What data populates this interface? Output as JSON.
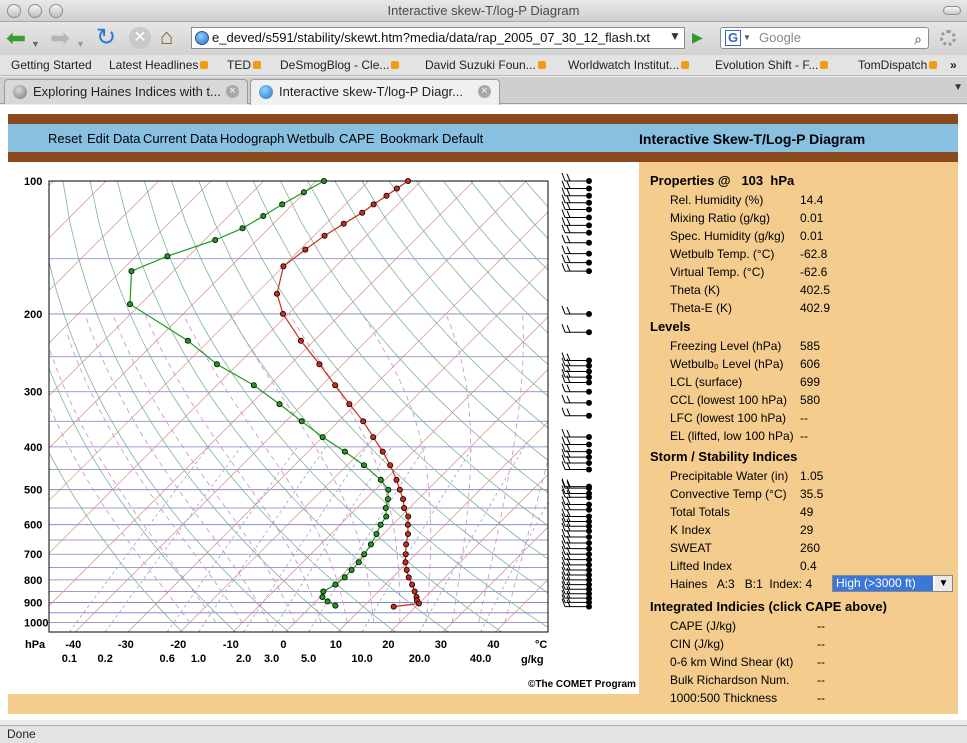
{
  "window": {
    "title": "Interactive skew-T/log-P Diagram"
  },
  "toolbar": {
    "url": "e_deved/s591/stability/skewt.htm?media/data/rap_2005_07_30_12_flash.txt",
    "search_placeholder": "Google",
    "back_icon": "back-arrow-icon",
    "forward_icon": "forward-arrow-icon",
    "reload_icon": "reload-icon",
    "stop_icon": "stop-icon",
    "home_icon": "home-icon"
  },
  "bookmarks": [
    {
      "label": "Getting Started",
      "rss": false
    },
    {
      "label": "Latest Headlines",
      "rss": true
    },
    {
      "label": "TED",
      "rss": true
    },
    {
      "label": "DeSmogBlog - Cle...",
      "rss": true
    },
    {
      "label": "David Suzuki Foun...",
      "rss": true
    },
    {
      "label": "Worldwatch Institut...",
      "rss": true
    },
    {
      "label": "Evolution Shift - F...",
      "rss": true
    },
    {
      "label": "TomDispatch",
      "rss": true
    }
  ],
  "bookmarks_more": "»",
  "tabs": [
    {
      "label": "Exploring Haines Indices with t...",
      "active": false
    },
    {
      "label": "Interactive skew-T/log-P Diagr...",
      "active": true
    }
  ],
  "app": {
    "menu": [
      "Reset",
      "Edit Data",
      "Current Data",
      "Hodograph",
      "Wetbulb",
      "CAPE",
      "Bookmark",
      "Default"
    ],
    "title": "Interactive Skew-T/Log-P Diagram",
    "copyright": "©The COMET Program"
  },
  "properties": {
    "header_label": "Properties @",
    "pressure": "103",
    "unit": "hPa",
    "items": [
      {
        "label": "Rel. Humidity (%)",
        "value": "14.4"
      },
      {
        "label": "Mixing Ratio (g/kg)",
        "value": "0.01"
      },
      {
        "label": "Spec. Humidity (g/kg)",
        "value": "0.01"
      },
      {
        "label": "Wetbulb Temp. (°C)",
        "value": "-62.8"
      },
      {
        "label": "Virtual Temp. (°C)",
        "value": "-62.6"
      },
      {
        "label": "Theta (K)",
        "value": "402.5"
      },
      {
        "label": "Theta-E (K)",
        "value": "402.9"
      }
    ]
  },
  "levels": {
    "header": "Levels",
    "items": [
      {
        "label": "Freezing Level (hPa)",
        "value": "585"
      },
      {
        "label": "Wetbulb₀ Level (hPa)",
        "value": "606"
      },
      {
        "label": "LCL (surface)",
        "value": "699"
      },
      {
        "label": "CCL (lowest 100 hPa)",
        "value": "580"
      },
      {
        "label": "LFC (lowest 100 hPa)",
        "value": "--"
      },
      {
        "label": "EL (lifted, low 100 hPa)",
        "value": "--"
      }
    ]
  },
  "stability": {
    "header": "Storm / Stability Indices",
    "items": [
      {
        "label": "Precipitable Water (in)",
        "value": "1.05"
      },
      {
        "label": "Convective Temp (°C)",
        "value": "35.5"
      },
      {
        "label": "Total Totals",
        "value": "49"
      },
      {
        "label": "K Index",
        "value": "29"
      },
      {
        "label": "SWEAT",
        "value": "260"
      },
      {
        "label": "Lifted Index",
        "value": "0.4"
      }
    ],
    "haines": {
      "label": "Haines",
      "a": "A:3",
      "b": "B:1",
      "index": "Index: 4",
      "select": "High (>3000 ft)"
    }
  },
  "integrated": {
    "header": "Integrated Indicies (click CAPE above)",
    "items": [
      {
        "label": "CAPE (J/kg)",
        "value": "--"
      },
      {
        "label": "CIN (J/kg)",
        "value": "--"
      },
      {
        "label": "0-6 km Wind Shear (kt)",
        "value": "--"
      },
      {
        "label": "Bulk Richardson Num.",
        "value": "--"
      },
      {
        "label": "1000:500 Thickness",
        "value": "--"
      }
    ]
  },
  "status": {
    "text": "Done"
  },
  "chart_data": {
    "type": "line",
    "title": "",
    "xlabel": "°C",
    "ylabel": "hPa",
    "p_ticks": [
      "100",
      "200",
      "300",
      "400",
      "500",
      "600",
      "700",
      "800",
      "900",
      "1000"
    ],
    "t_ticks": [
      "-40",
      "-30",
      "-20",
      "-10",
      "0",
      "10",
      "20",
      "30",
      "40"
    ],
    "w_ticks": [
      "0.1",
      "0.2",
      "0.6",
      "1.0",
      "2.0",
      "3.0",
      "5.0",
      "10.0",
      "20.0",
      "40.0"
    ],
    "w_unit": "g/kg",
    "xlim": [
      -45,
      50
    ],
    "ylim": [
      1050,
      100
    ],
    "log_p": true,
    "skewed": true,
    "series": [
      {
        "color": "#cc2a1a",
        "points": [
          [
            100,
            -62.5
          ],
          [
            104,
            -63.2
          ],
          [
            108,
            -63.8
          ],
          [
            113,
            -64.6
          ],
          [
            118,
            -65.2
          ],
          [
            125,
            -66.6
          ],
          [
            133,
            -68.0
          ],
          [
            143,
            -69.0
          ],
          [
            156,
            -70.0
          ],
          [
            180,
            -66.0
          ],
          [
            200,
            -61.0
          ],
          [
            230,
            -52.5
          ],
          [
            260,
            -44.5
          ],
          [
            290,
            -37.5
          ],
          [
            320,
            -31.2
          ],
          [
            350,
            -25.3
          ],
          [
            380,
            -20.4
          ],
          [
            410,
            -15.8
          ],
          [
            440,
            -11.8
          ],
          [
            475,
            -7.8
          ],
          [
            500,
            -5.3
          ],
          [
            525,
            -2.9
          ],
          [
            550,
            -1.0
          ],
          [
            575,
            1.4
          ],
          [
            600,
            2.9
          ],
          [
            630,
            4.7
          ],
          [
            665,
            6.3
          ],
          [
            700,
            8.1
          ],
          [
            730,
            9.6
          ],
          [
            760,
            11.3
          ],
          [
            790,
            13.1
          ],
          [
            820,
            15.1
          ],
          [
            850,
            16.9
          ],
          [
            875,
            18.3
          ],
          [
            890,
            19.0
          ],
          [
            905,
            20.0
          ],
          [
            920,
            15.8
          ]
        ]
      },
      {
        "color": "#1f9a1f",
        "points": [
          [
            100,
            -78.5
          ],
          [
            106,
            -80.2
          ],
          [
            113,
            -82.0
          ],
          [
            120,
            -83.4
          ],
          [
            128,
            -85.0
          ],
          [
            136,
            -88.0
          ],
          [
            148,
            -94.0
          ],
          [
            160,
            -98.0
          ],
          [
            190,
            -92.0
          ],
          [
            230,
            -74.0
          ],
          [
            260,
            -64.0
          ],
          [
            290,
            -53.0
          ],
          [
            320,
            -44.5
          ],
          [
            350,
            -37.0
          ],
          [
            380,
            -30.0
          ],
          [
            410,
            -23.0
          ],
          [
            440,
            -16.8
          ],
          [
            475,
            -10.8
          ],
          [
            500,
            -7.5
          ],
          [
            525,
            -5.8
          ],
          [
            550,
            -4.5
          ],
          [
            575,
            -2.8
          ],
          [
            600,
            -2.3
          ],
          [
            630,
            -1.3
          ],
          [
            665,
            -0.4
          ],
          [
            700,
            0.2
          ],
          [
            730,
            0.7
          ],
          [
            760,
            0.8
          ],
          [
            790,
            0.9
          ],
          [
            820,
            0.5
          ],
          [
            850,
            -0.5
          ],
          [
            875,
            0.4
          ],
          [
            895,
            2.2
          ],
          [
            915,
            4.5
          ]
        ]
      }
    ]
  }
}
